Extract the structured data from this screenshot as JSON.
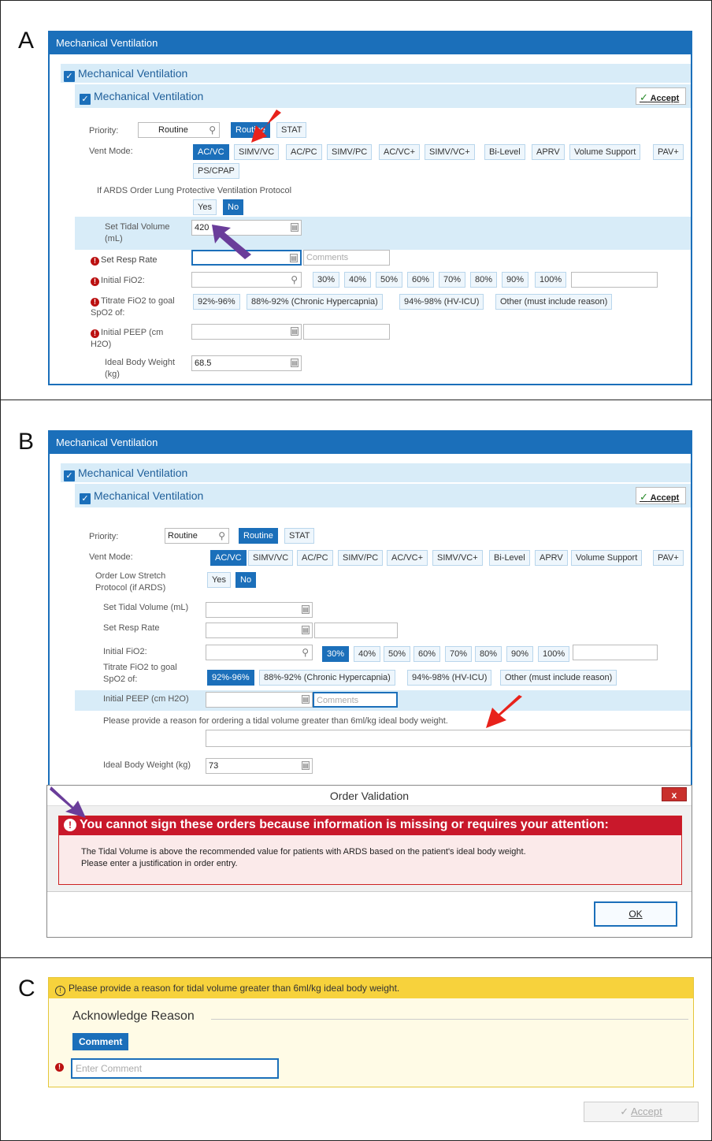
{
  "panels": {
    "a": {
      "letter": "A",
      "title": "Mechanical Ventilation",
      "section1": "Mechanical Ventilation",
      "section2": "Mechanical Ventilation",
      "accept": "Accept",
      "priority_label": "Priority:",
      "priority_value": "Routine",
      "priority_buttons": [
        "Routine",
        "STAT"
      ],
      "vent_mode_label": "Vent Mode:",
      "vent_modes": [
        "AC/VC",
        "SIMV/VC",
        "AC/PC",
        "SIMV/PC",
        "AC/VC+",
        "SIMV/VC+",
        "Bi-Level",
        "APRV",
        "Volume Support",
        "PAV+",
        "PS/CPAP"
      ],
      "ards_label": "If ARDS Order Lung Protective Ventilation Protocol",
      "yes": "Yes",
      "no": "No",
      "tidal_label": "Set Tidal Volume (mL)",
      "tidal_value": "420",
      "resp_label": "Set Resp Rate",
      "comments_placeholder": "Comments",
      "fio2_label": "Initial FiO2:",
      "fio2_options": [
        "30%",
        "40%",
        "50%",
        "60%",
        "70%",
        "80%",
        "90%",
        "100%"
      ],
      "titrate_label": "Titrate FiO2 to goal SpO2 of:",
      "titrate_options": [
        "92%-96%",
        "88%-92% (Chronic Hypercapnia)",
        "94%-98% (HV-ICU)",
        "Other (must include reason)"
      ],
      "peep_label": "Initial PEEP (cm H2O)",
      "ibw_label": "Ideal Body Weight (kg)",
      "ibw_value": "68.5"
    },
    "b": {
      "letter": "B",
      "title": "Mechanical Ventilation",
      "section1": "Mechanical Ventilation",
      "section2": "Mechanical Ventilation",
      "accept": "Accept",
      "priority_label": "Priority:",
      "priority_value": "Routine",
      "priority_buttons": [
        "Routine",
        "STAT"
      ],
      "vent_mode_label": "Vent Mode:",
      "vent_modes": [
        "AC/VC",
        "SIMV/VC",
        "AC/PC",
        "SIMV/PC",
        "AC/VC+",
        "SIMV/VC+",
        "Bi-Level",
        "APRV",
        "Volume Support",
        "PAV+"
      ],
      "low_stretch_label": "Order Low Stretch Protocol (if ARDS)",
      "yes": "Yes",
      "no": "No",
      "tidal_label": "Set Tidal Volume (mL)",
      "resp_label": "Set Resp Rate",
      "fio2_label": "Initial FiO2:",
      "fio2_options": [
        "30%",
        "40%",
        "50%",
        "60%",
        "70%",
        "80%",
        "90%",
        "100%"
      ],
      "titrate_label": "Titrate FiO2 to goal SpO2 of:",
      "titrate_options": [
        "92%-96%",
        "88%-92% (Chronic Hypercapnia)",
        "94%-98% (HV-ICU)",
        "Other (must include reason)"
      ],
      "peep_label": "Initial PEEP (cm H2O)",
      "comments_placeholder": "Comments",
      "reason_prompt": "Please provide a reason for ordering a tidal volume greater than 6ml/kg ideal body weight.",
      "ibw_label": "Ideal Body Weight (kg)",
      "ibw_value": "73",
      "dialog": {
        "title": "Order Validation",
        "close": "x",
        "error_head": "You cannot sign these orders because information is missing or requires your attention:",
        "error_line1": "The Tidal Volume is above the recommended value for patients with ARDS based on the patient's ideal body weight.",
        "error_line2": "Please enter a justification in order entry.",
        "ok": "OK"
      }
    },
    "c": {
      "letter": "C",
      "banner": "Please provide a reason for tidal volume greater than 6ml/kg ideal body weight.",
      "ack_title": "Acknowledge Reason",
      "comment_button": "Comment",
      "comment_placeholder": "Enter Comment",
      "accept": "Accept"
    }
  },
  "colors": {
    "accent": "#1b6fba",
    "error": "#c9182b",
    "warning": "#f7d23c",
    "arrow_red": "#e8221b",
    "arrow_purple": "#6a3d9a"
  }
}
